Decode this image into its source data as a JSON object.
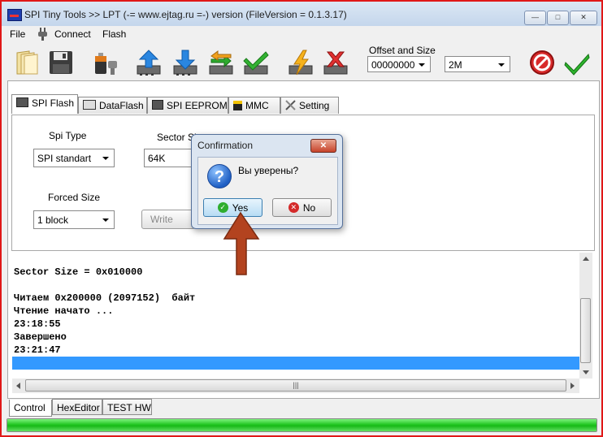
{
  "window": {
    "title": "SPI Tiny Tools  >> LPT (-= www.ejtag.ru =-) version (FileVersion = 0.1.3.17)",
    "minimize_glyph": "—",
    "maximize_glyph": "□",
    "close_glyph": "✕"
  },
  "menu": {
    "file": "File",
    "connect": "Connect",
    "flash": "Flash"
  },
  "toolbar": {
    "offset_size_label": "Offset and Size",
    "offset_value": "00000000",
    "size_value": "2M",
    "icons": [
      "open-file-icon",
      "save-icon",
      "battery-plug-icon",
      "upload-icon",
      "download-icon",
      "compare-icon",
      "verify-icon",
      "lightning-icon",
      "erase-icon",
      "stop-icon",
      "ok-icon"
    ]
  },
  "tabs": [
    {
      "label": "SPI Flash",
      "icon": "chip-icon"
    },
    {
      "label": "DataFlash",
      "icon": "dataflash-icon"
    },
    {
      "label": "SPI EEPROM",
      "icon": "eeprom-icon"
    },
    {
      "label": "MMC",
      "icon": "memory-card-icon"
    },
    {
      "label": "Setting",
      "icon": "tools-icon"
    }
  ],
  "spi_flash": {
    "spi_type_label": "Spi Type",
    "spi_type_value": "SPI standart",
    "sector_size_label": "Sector Si",
    "sector_size_value": "64K",
    "forced_size_label": "Forced Size",
    "forced_size_value": "1 block",
    "write_sector_button": "Write Secu"
  },
  "log": {
    "lines": [
      "Sector Size = 0x010000",
      "",
      "Читаем 0x200000 (2097152)  байт",
      "Чтение начато ...",
      "23:18:55",
      "Завершено",
      "23:21:47",
      ""
    ],
    "scroll_thumb": "|||"
  },
  "bottom_tabs": [
    "Control",
    "HexEditor",
    "TEST HW"
  ],
  "progress": {
    "fraction": 1.0
  },
  "dialog": {
    "title": "Confirmation",
    "close_glyph": "✕",
    "message": "Вы уверены?",
    "question_glyph": "?",
    "yes": "Yes",
    "no": "No"
  },
  "colors": {
    "accent_red": "#e01818",
    "selection": "#3399ff",
    "progress_green": "#22c622",
    "annotation_arrow": "#b3431f"
  }
}
